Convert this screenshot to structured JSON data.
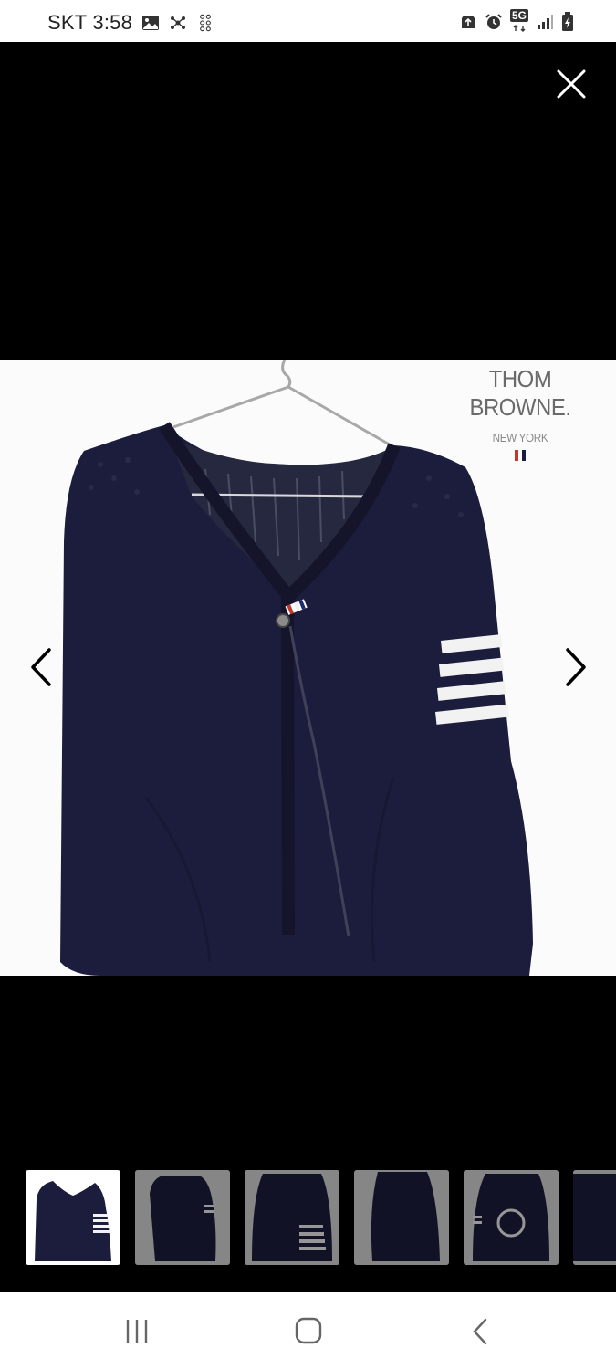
{
  "status_bar": {
    "carrier": "SKT",
    "time": "3:58",
    "network": "5G",
    "icons_left": [
      "gallery-icon",
      "sync-icon",
      "grid-dots-icon"
    ],
    "icons_right": [
      "recycle-icon",
      "alarm-icon",
      "network-5g-icon",
      "signal-icon",
      "battery-icon"
    ]
  },
  "viewer": {
    "close_icon": "close-icon",
    "prev_icon": "chevron-left-icon",
    "next_icon": "chevron-right-icon"
  },
  "product": {
    "brand": "THOM BROWNE.",
    "subtitle": "NEW YORK",
    "garment_color": "#1c1d3d",
    "stripe_color": "#f2f2f2",
    "flag_colors": [
      "#c0392b",
      "#1c1d3d"
    ]
  },
  "thumbnails": [
    {
      "name": "thumbnail-1",
      "selected": true,
      "variant": "front-stripes"
    },
    {
      "name": "thumbnail-2",
      "selected": false,
      "variant": "side"
    },
    {
      "name": "thumbnail-3",
      "selected": false,
      "variant": "stripes-closeup"
    },
    {
      "name": "thumbnail-4",
      "selected": false,
      "variant": "back"
    },
    {
      "name": "thumbnail-5",
      "selected": false,
      "variant": "logo-patch"
    },
    {
      "name": "thumbnail-6",
      "selected": false,
      "variant": "partial"
    }
  ],
  "system_nav": {
    "recents_icon": "recents-icon",
    "home_icon": "home-icon",
    "back_icon": "back-icon"
  }
}
